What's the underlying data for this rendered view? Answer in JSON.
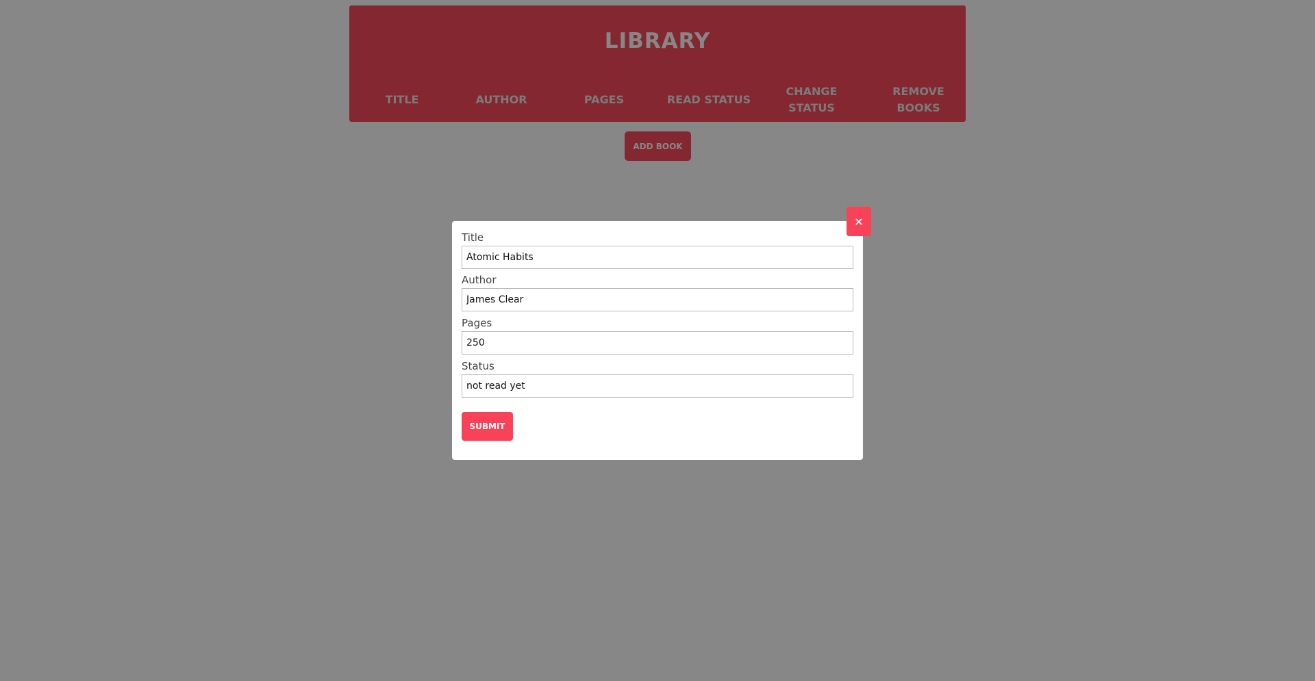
{
  "header": {
    "title": "LIBRARY",
    "columns": [
      {
        "label": "TITLE"
      },
      {
        "label": "AUTHOR"
      },
      {
        "label": "PAGES"
      },
      {
        "label": "READ STATUS"
      },
      {
        "label": "CHANGE\nSTATUS"
      },
      {
        "label": "REMOVE\nBOOKS"
      }
    ]
  },
  "add_book_label": "ADD BOOK",
  "modal": {
    "close_label": "×",
    "fields": [
      {
        "label": "Title",
        "value": "Atomic Habits"
      },
      {
        "label": "Author",
        "value": "James Clear"
      },
      {
        "label": "Pages",
        "value": "250"
      },
      {
        "label": "Status",
        "value": "not read yet"
      }
    ],
    "submit_label": "SUBMIT"
  },
  "colors": {
    "accent": "#f94a5d",
    "overlay": "rgba(0,0,0,0.47)",
    "modal_background": "#ffffff"
  }
}
